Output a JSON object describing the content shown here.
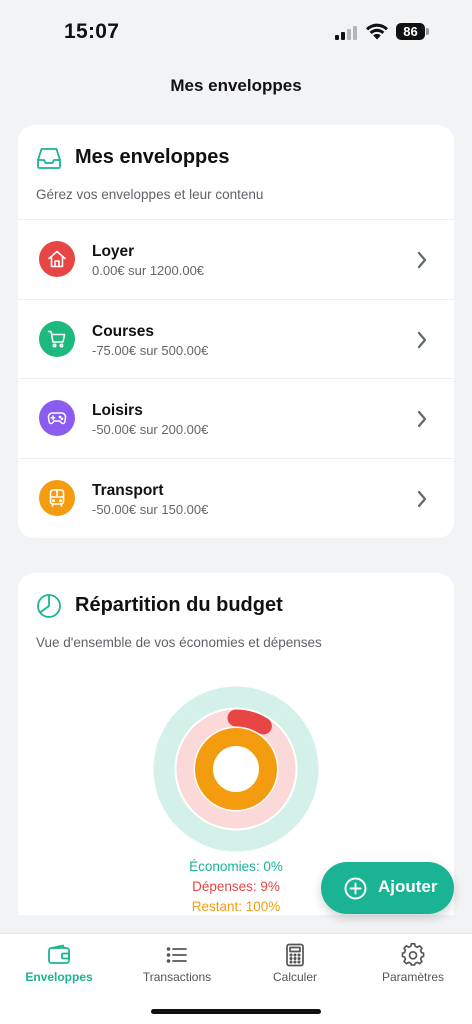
{
  "status": {
    "time": "15:07",
    "battery": "86"
  },
  "page": {
    "title": "Mes enveloppes"
  },
  "envelopes_card": {
    "title": "Mes enveloppes",
    "subtitle": "Gérez vos enveloppes et leur contenu",
    "icon": "inbox-tray-icon",
    "items": [
      {
        "name": "Loyer",
        "amount": "0.00€ sur 1200.00€",
        "icon": "home-icon",
        "color": "#e84545"
      },
      {
        "name": "Courses",
        "amount": "-75.00€ sur 500.00€",
        "icon": "shopping-cart-icon",
        "color": "#1db97e"
      },
      {
        "name": "Loisirs",
        "amount": "-50.00€ sur 200.00€",
        "icon": "gamepad-icon",
        "color": "#8a5cf0"
      },
      {
        "name": "Transport",
        "amount": "-50.00€ sur 150.00€",
        "icon": "bus-icon",
        "color": "#f39c0f"
      }
    ]
  },
  "budget_card": {
    "title": "Répartition du budget",
    "subtitle": "Vue d'ensemble de vos économies et dépenses",
    "icon": "pie-chart-icon",
    "legend": {
      "savings": "Économies: 0%",
      "expenses": "Dépenses: 9%",
      "remaining": "Restant: 100%"
    },
    "rings": {
      "savings_fraction": 0.0,
      "expenses_fraction": 0.09,
      "remaining_fraction": 1.0
    },
    "colors": {
      "savings": "#1ab394",
      "savings_track": "#d3f1e8",
      "expenses": "#e84545",
      "expenses_track": "#fcd9d9",
      "remaining": "#f39c0f"
    }
  },
  "fab": {
    "label": "Ajouter",
    "icon": "plus-circle-icon"
  },
  "tabs": [
    {
      "label": "Enveloppes",
      "icon": "wallet-icon",
      "active": true
    },
    {
      "label": "Transactions",
      "icon": "list-icon",
      "active": false
    },
    {
      "label": "Calculer",
      "icon": "calculator-icon",
      "active": false
    },
    {
      "label": "Paramètres",
      "icon": "gear-icon",
      "active": false
    }
  ],
  "colors": {
    "accent": "#1ab394",
    "background": "#f2f3f5"
  }
}
